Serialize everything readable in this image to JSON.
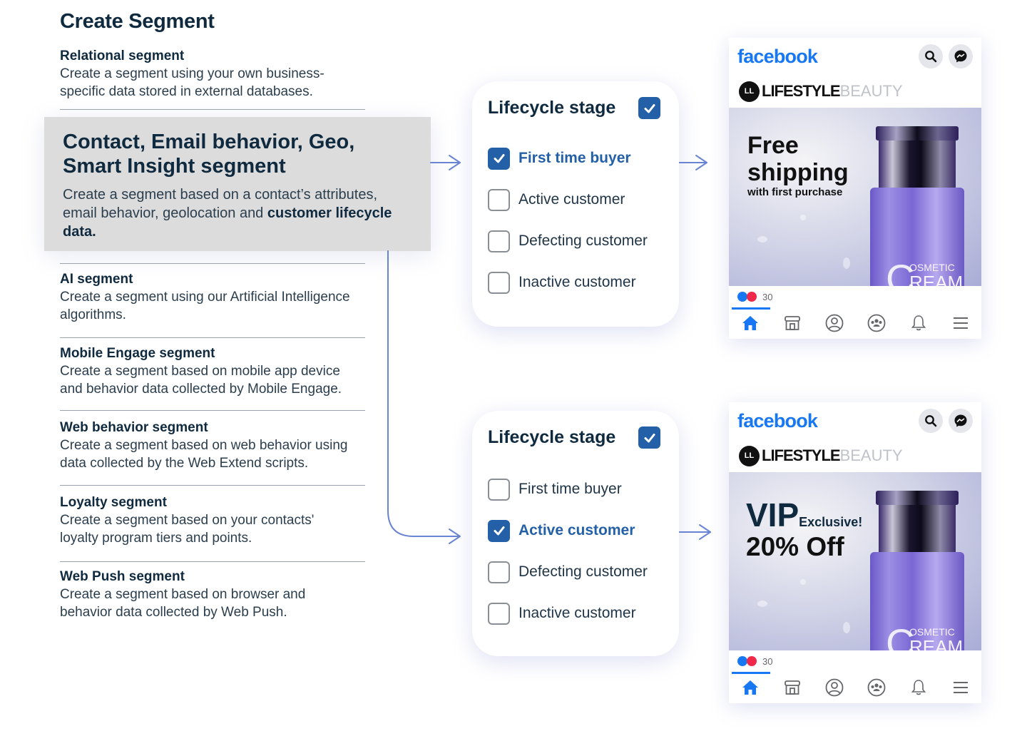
{
  "title": "Create Segment",
  "segments": [
    {
      "name": "Relational segment",
      "desc": "Create a segment using your own business-specific data stored in external databases."
    },
    {
      "name": "AI segment",
      "desc": "Create a segment using our Artificial Intelligence algorithms."
    },
    {
      "name": "Mobile Engage segment",
      "desc": "Create a segment based on mobile app device and behavior data collected by Mobile Engage."
    },
    {
      "name": "Web behavior segment",
      "desc": "Create a segment based on web behavior using data collected by the Web Extend scripts."
    },
    {
      "name": "Loyalty segment",
      "desc": "Create a segment based on your contacts' loyalty program tiers and points."
    },
    {
      "name": "Web Push segment",
      "desc": "Create a segment based on browser and behavior data collected by Web Push."
    }
  ],
  "highlighted": {
    "name": "Contact, Email behavior, Geo, Smart Insight segment",
    "desc_plain": "Create a segment based on a contact’s attributes, email behavior, geolocation and ",
    "desc_bold": "customer lifecycle data."
  },
  "cards": [
    {
      "title": "Lifecycle stage",
      "header_checked": true,
      "options": [
        {
          "label": "First time buyer",
          "checked": true
        },
        {
          "label": "Active customer",
          "checked": false
        },
        {
          "label": "Defecting customer",
          "checked": false
        },
        {
          "label": "Inactive customer",
          "checked": false
        }
      ]
    },
    {
      "title": "Lifecycle stage",
      "header_checked": true,
      "options": [
        {
          "label": "First time buyer",
          "checked": false
        },
        {
          "label": "Active customer",
          "checked": true
        },
        {
          "label": "Defecting customer",
          "checked": false
        },
        {
          "label": "Inactive customer",
          "checked": false
        }
      ]
    }
  ],
  "posts": [
    {
      "app": "facebook",
      "brand_a": "LIFESTYLE",
      "brand_b": "BEAUTY",
      "brand_badge": "LL",
      "ad_line1": "Free",
      "ad_line2": "shipping",
      "ad_line3": "with first purchase",
      "product_a": "OSMETIC",
      "product_b": "REAM",
      "product_c": "C",
      "reactions": "30"
    },
    {
      "app": "facebook",
      "brand_a": "LIFESTYLE",
      "brand_b": "BEAUTY",
      "brand_badge": "LL",
      "ad_vip": "VIP",
      "ad_exclusive": "Exclusive!",
      "ad_offer": "20% Off",
      "product_a": "OSMETIC",
      "product_b": "REAM",
      "product_c": "C",
      "reactions": "30"
    }
  ],
  "colors": {
    "accent": "#2460a7",
    "connector": "#6a84d4",
    "facebook": "#1877f2",
    "highlight_bg": "#dcdcdc"
  }
}
